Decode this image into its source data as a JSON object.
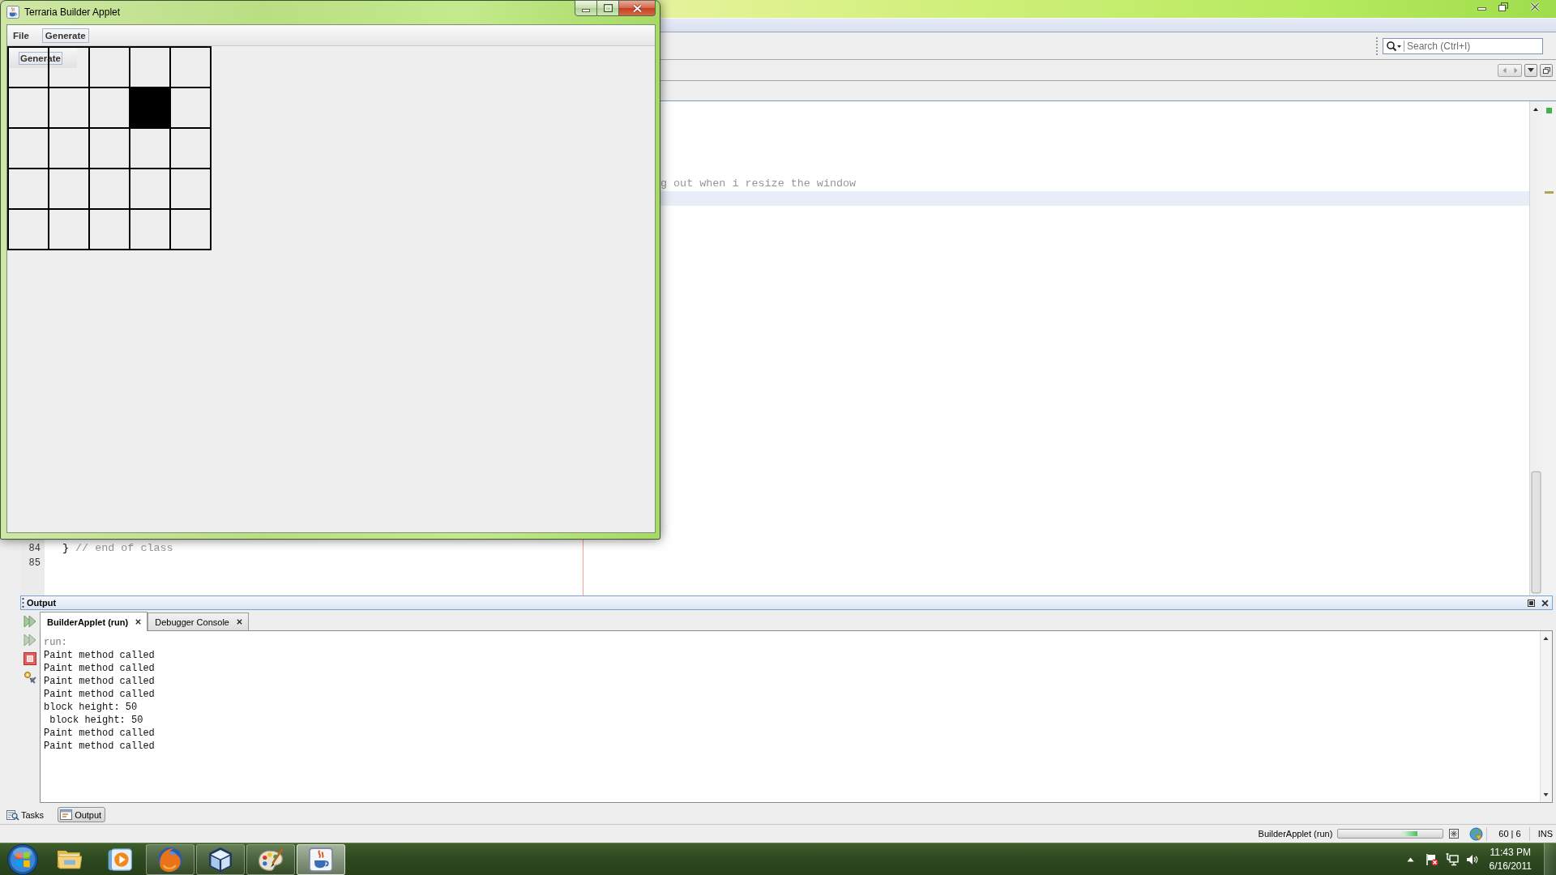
{
  "applet_window": {
    "title": "Terraria Builder Applet",
    "menu": [
      {
        "label": "File",
        "selected": false
      },
      {
        "label": "Generate",
        "selected": true
      }
    ],
    "popup_menu": [
      {
        "label": "Generate",
        "selected": true
      }
    ],
    "grid": [
      [
        {
          "filled": false
        },
        {
          "filled": false
        },
        {
          "filled": false
        },
        {
          "filled": false
        },
        {
          "filled": false
        }
      ],
      [
        {
          "filled": false
        },
        {
          "filled": false
        },
        {
          "filled": false
        },
        {
          "filled": true
        },
        {
          "filled": false
        }
      ],
      [
        {
          "filled": false
        },
        {
          "filled": false
        },
        {
          "filled": false
        },
        {
          "filled": false
        },
        {
          "filled": false
        }
      ],
      [
        {
          "filled": false
        },
        {
          "filled": false
        },
        {
          "filled": false
        },
        {
          "filled": false
        },
        {
          "filled": false
        }
      ],
      [
        {
          "filled": false
        },
        {
          "filled": false
        },
        {
          "filled": false
        },
        {
          "filled": false
        },
        {
          "filled": false
        }
      ]
    ]
  },
  "ide": {
    "search": {
      "placeholder": "Search (Ctrl+I)"
    },
    "editor": {
      "top_lines": [
        {
          "comment": "g out when i resize the window",
          "current": false
        },
        {
          "current": true
        }
      ],
      "bottom_lines": [
        {
          "number": "84",
          "code": "}",
          "comment": "// end of class",
          "current": false
        },
        {
          "number": "85",
          "current": false
        }
      ]
    },
    "output": {
      "title": "Output",
      "tabs": [
        {
          "label": "BuilderApplet (run)",
          "selected": true
        },
        {
          "label": "Debugger Console",
          "selected": false
        }
      ],
      "lines": [
        {
          "kind": "meta",
          "text": "run:"
        },
        {
          "kind": "out",
          "text": "Paint method called"
        },
        {
          "kind": "out",
          "text": "Paint method called"
        },
        {
          "kind": "out",
          "text": "Paint method called"
        },
        {
          "kind": "out",
          "text": "Paint method called"
        },
        {
          "kind": "out",
          "text": "block height: 50"
        },
        {
          "kind": "out",
          "text": " block height: 50"
        },
        {
          "kind": "out",
          "text": "Paint method called"
        },
        {
          "kind": "out",
          "text": "Paint method called"
        }
      ]
    },
    "panel_buttons": [
      {
        "label": "Tasks",
        "selected": false
      },
      {
        "label": "Output",
        "selected": true
      }
    ],
    "status_bar": {
      "task": "BuilderApplet (run)",
      "progress": {
        "level": 0.76
      },
      "position": "60 | 6",
      "mode": "INS"
    }
  },
  "taskbar": {
    "apps": [
      {
        "kind": "folder",
        "running": false,
        "selected": false
      },
      {
        "kind": "media",
        "running": false,
        "selected": false
      },
      {
        "kind": "browser",
        "running": true,
        "selected": false
      },
      {
        "kind": "cube",
        "running": true,
        "selected": false
      },
      {
        "kind": "paint",
        "running": true,
        "selected": false
      },
      {
        "kind": "java",
        "running": true,
        "selected": true
      }
    ],
    "clock": {
      "time": "11:43 PM",
      "date": "6/16/2011"
    }
  }
}
